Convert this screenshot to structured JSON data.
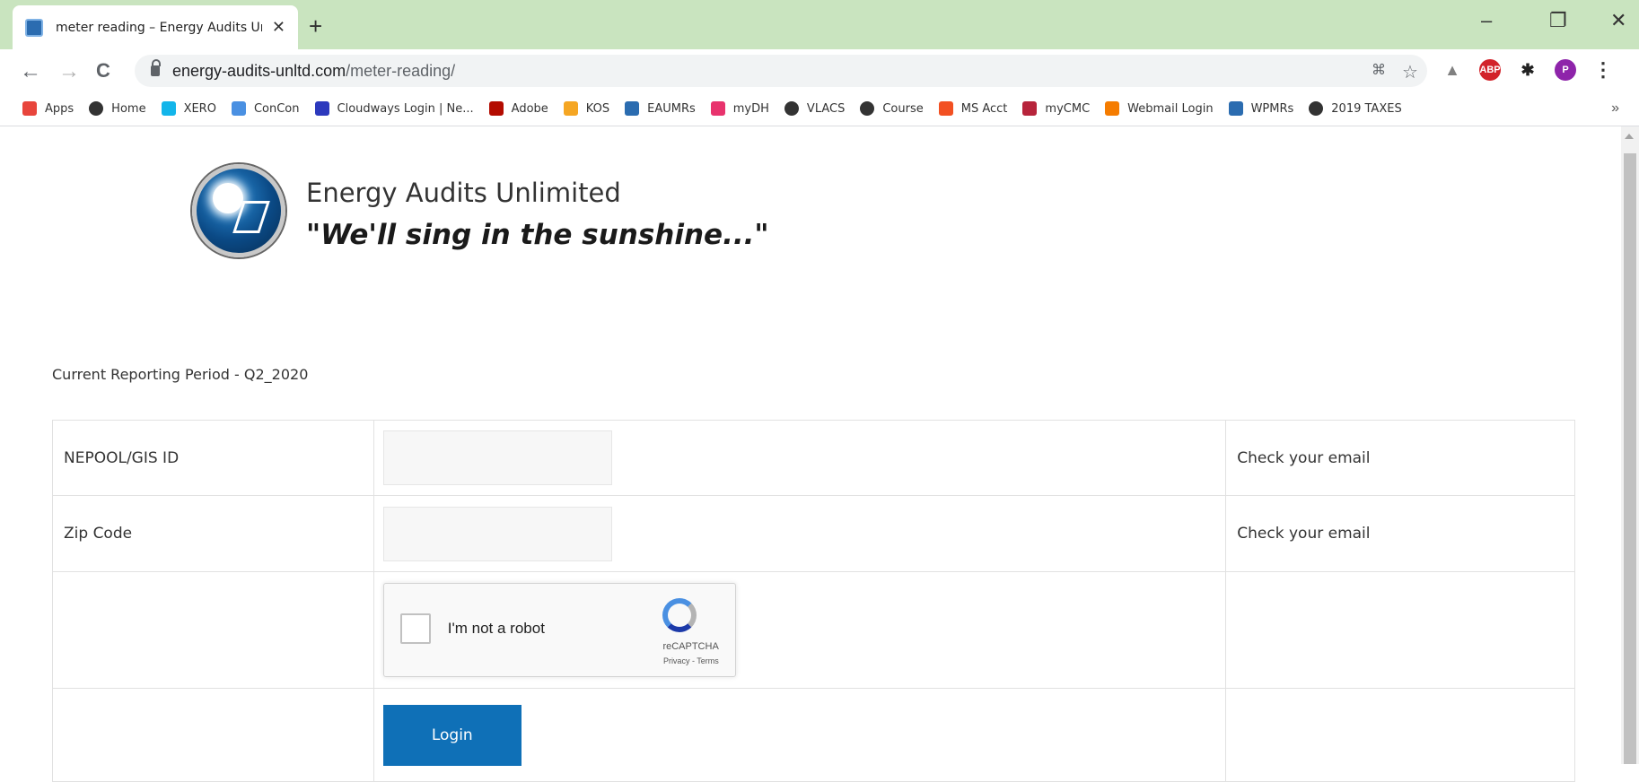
{
  "browser": {
    "tab": {
      "title": "meter reading – Energy Audits Unlin",
      "close_glyph": "✕"
    },
    "newtab_glyph": "+",
    "window_controls": {
      "minimize": "–",
      "restore": "❐",
      "close": "✕"
    },
    "nav": {
      "back": "←",
      "forward": "→",
      "reload": "C"
    },
    "address": {
      "host": "energy-audits-unltd.com",
      "path": "/meter-reading/"
    },
    "omnibox_icons": {
      "translate": "translate-icon",
      "star": "☆"
    },
    "extensions": [
      {
        "name": "drive-icon",
        "label": "▲",
        "color": "#808080"
      },
      {
        "name": "adblock-plus-icon",
        "label": "ABP",
        "color": "#d2232a"
      },
      {
        "name": "puzzle-icon",
        "label": "✱",
        "color": "#222222"
      },
      {
        "name": "profile-avatar",
        "label": "P",
        "color": "#8e24aa"
      },
      {
        "name": "menu-icon",
        "label": "⋮",
        "color": "#333333"
      }
    ],
    "bookmarks": [
      {
        "label": "Apps",
        "icon": "apps-grid-icon",
        "color": "#e8453c"
      },
      {
        "label": "Home",
        "icon": "globe-icon",
        "color": "#333333"
      },
      {
        "label": "XERO",
        "icon": "xero-icon",
        "color": "#13b5ea"
      },
      {
        "label": "ConCon",
        "icon": "concon-icon",
        "color": "#4a90e2"
      },
      {
        "label": "Cloudways Login | Ne...",
        "icon": "cloud-icon",
        "color": "#2c39bd"
      },
      {
        "label": "Adobe",
        "icon": "adobe-icon",
        "color": "#b30b00"
      },
      {
        "label": "KOS",
        "icon": "kos-icon",
        "color": "#f5a623"
      },
      {
        "label": "EAUMRs",
        "icon": "eaumrs-icon",
        "color": "#2b6cb0"
      },
      {
        "label": "myDH",
        "icon": "gift-icon",
        "color": "#e8336d"
      },
      {
        "label": "VLACS",
        "icon": "globe-icon",
        "color": "#333333"
      },
      {
        "label": "Course",
        "icon": "course-icon",
        "color": "#333333"
      },
      {
        "label": "MS Acct",
        "icon": "microsoft-icon",
        "color": "#f25022"
      },
      {
        "label": "myCMC",
        "icon": "cmc-icon",
        "color": "#b7243b"
      },
      {
        "label": "Webmail Login",
        "icon": "webmail-icon",
        "color": "#f57c00"
      },
      {
        "label": "WPMRs",
        "icon": "wpmrs-icon",
        "color": "#2b6cb0"
      },
      {
        "label": "2019 TAXES",
        "icon": "globe-icon",
        "color": "#333333"
      }
    ],
    "bookmarks_more": "»"
  },
  "page": {
    "brand": {
      "name": "Energy Audits Unlimited",
      "tagline": "\"We'll sing in the sunshine...\""
    },
    "period": "Current Reporting Period - Q2_2020",
    "form": {
      "rows": [
        {
          "label": "NEPOOL/GIS ID",
          "value": "",
          "hint": "Check your email"
        },
        {
          "label": "Zip Code",
          "value": "",
          "hint": "Check your email"
        }
      ],
      "captcha": {
        "label": "I'm not a robot",
        "brand": "reCAPTCHA",
        "links": "Privacy - Terms"
      },
      "submit_label": "Login"
    }
  },
  "colors": {
    "titlebar": "#c9e4bf",
    "button": "#0f70b7"
  }
}
